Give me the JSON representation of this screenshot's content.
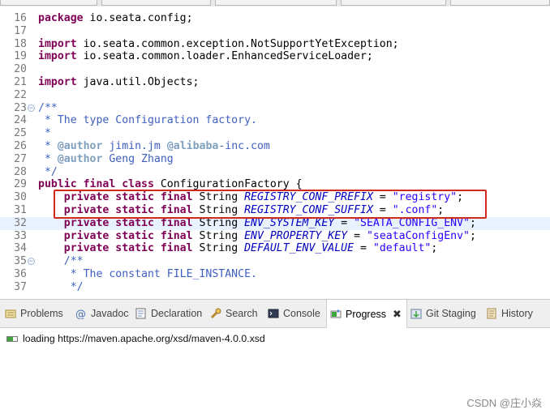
{
  "editor": {
    "lines": [
      {
        "n": "16",
        "fold": false,
        "parts": [
          [
            "kw",
            "package"
          ],
          [
            "t",
            " io.seata.config;"
          ]
        ]
      },
      {
        "n": "17",
        "fold": false,
        "parts": []
      },
      {
        "n": "18",
        "fold": false,
        "parts": [
          [
            "kw",
            "import"
          ],
          [
            "t",
            " io.seata.common.exception.NotSupportYetException;"
          ]
        ]
      },
      {
        "n": "19",
        "fold": false,
        "parts": [
          [
            "kw",
            "import"
          ],
          [
            "t",
            " io.seata.common.loader.EnhancedServiceLoader;"
          ]
        ]
      },
      {
        "n": "20",
        "fold": false,
        "parts": []
      },
      {
        "n": "21",
        "fold": false,
        "parts": [
          [
            "kw",
            "import"
          ],
          [
            "t",
            " java.util.Objects;"
          ]
        ]
      },
      {
        "n": "22",
        "fold": false,
        "parts": []
      },
      {
        "n": "23",
        "fold": true,
        "parts": [
          [
            "cm",
            "/**"
          ]
        ]
      },
      {
        "n": "24",
        "fold": false,
        "parts": [
          [
            "cm",
            " * The type Configuration factory."
          ]
        ]
      },
      {
        "n": "25",
        "fold": false,
        "parts": [
          [
            "cm",
            " *"
          ]
        ]
      },
      {
        "n": "26",
        "fold": false,
        "parts": [
          [
            "cm",
            " * "
          ],
          [
            "tag",
            "@author"
          ],
          [
            "cm",
            " jimin.jm "
          ],
          [
            "tag",
            "@alibaba"
          ],
          [
            "cm",
            "-inc.com"
          ]
        ]
      },
      {
        "n": "27",
        "fold": false,
        "parts": [
          [
            "cm",
            " * "
          ],
          [
            "tag",
            "@author"
          ],
          [
            "cm",
            " Geng Zhang"
          ]
        ]
      },
      {
        "n": "28",
        "fold": false,
        "parts": [
          [
            "cm",
            " */"
          ]
        ]
      },
      {
        "n": "29",
        "fold": false,
        "parts": [
          [
            "kw",
            "public final class"
          ],
          [
            "t",
            " ConfigurationFactory {"
          ]
        ]
      },
      {
        "n": "30",
        "fold": false,
        "parts": [
          [
            "t",
            "    "
          ],
          [
            "kw",
            "private static final"
          ],
          [
            "t",
            " String "
          ],
          [
            "fld",
            "REGISTRY_CONF_PREFIX"
          ],
          [
            "t",
            " = "
          ],
          [
            "str",
            "\"registry\""
          ],
          [
            "t",
            ";"
          ]
        ]
      },
      {
        "n": "31",
        "fold": false,
        "parts": [
          [
            "t",
            "    "
          ],
          [
            "kw",
            "private static final"
          ],
          [
            "t",
            " String "
          ],
          [
            "fld",
            "REGISTRY_CONF_SUFFIX"
          ],
          [
            "t",
            " = "
          ],
          [
            "str",
            "\".conf\""
          ],
          [
            "t",
            ";"
          ]
        ]
      },
      {
        "n": "32",
        "fold": false,
        "current": true,
        "parts": [
          [
            "t",
            "    "
          ],
          [
            "kw",
            "private static final"
          ],
          [
            "t",
            " String "
          ],
          [
            "fld",
            "ENV_SYSTEM_KEY"
          ],
          [
            "t",
            " = "
          ],
          [
            "str",
            "\"SEATA_CONFIG_ENV\""
          ],
          [
            "t",
            ";"
          ]
        ]
      },
      {
        "n": "33",
        "fold": false,
        "parts": [
          [
            "t",
            "    "
          ],
          [
            "kw",
            "private static final"
          ],
          [
            "t",
            " String "
          ],
          [
            "fld",
            "ENV_PROPERTY_KEY"
          ],
          [
            "t",
            " = "
          ],
          [
            "str",
            "\"seataConfigEnv\""
          ],
          [
            "t",
            ";"
          ]
        ]
      },
      {
        "n": "34",
        "fold": false,
        "parts": [
          [
            "t",
            "    "
          ],
          [
            "kw",
            "private static final"
          ],
          [
            "t",
            " String "
          ],
          [
            "fld",
            "DEFAULT_ENV_VALUE"
          ],
          [
            "t",
            " = "
          ],
          [
            "str",
            "\"default\""
          ],
          [
            "t",
            ";"
          ]
        ]
      },
      {
        "n": "35",
        "fold": true,
        "parts": [
          [
            "t",
            "    "
          ],
          [
            "cm",
            "/**"
          ]
        ]
      },
      {
        "n": "36",
        "fold": false,
        "parts": [
          [
            "cm",
            "     * The constant FILE_INSTANCE."
          ]
        ]
      },
      {
        "n": "37",
        "fold": false,
        "parts": [
          [
            "cm",
            "     */"
          ]
        ]
      }
    ]
  },
  "colors": {
    "keyword": "#7f0055",
    "comment": "#3f5fbf",
    "javadoc_tag": "#7f9fbf",
    "field": "#0000c0",
    "string": "#2a00ff",
    "highlight_box": "#d1291c",
    "current_line": "#e8f2fe"
  },
  "panel": {
    "tabs": [
      {
        "label": "Problems",
        "icon": "problems-icon"
      },
      {
        "label": "Javadoc",
        "icon": "javadoc-icon"
      },
      {
        "label": "Declaration",
        "icon": "declaration-icon"
      },
      {
        "label": "Search",
        "icon": "search-icon"
      },
      {
        "label": "Console",
        "icon": "console-icon"
      },
      {
        "label": "Progress",
        "icon": "progress-icon",
        "active": true,
        "close": "✖"
      },
      {
        "label": "Git Staging",
        "icon": "git-staging-icon"
      },
      {
        "label": "History",
        "icon": "history-icon"
      }
    ],
    "progress_message": "loading https://maven.apache.org/xsd/maven-4.0.0.xsd"
  },
  "watermark": "CSDN @庄小焱"
}
